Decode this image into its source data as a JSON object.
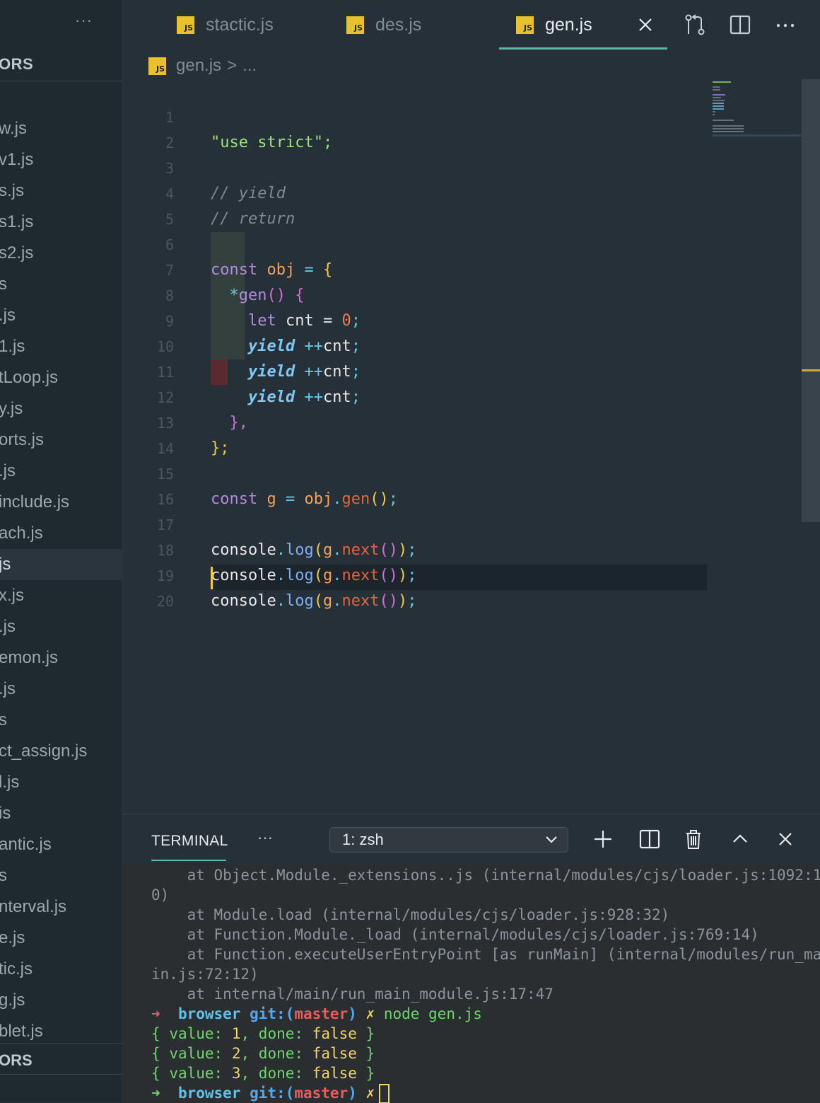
{
  "sidebar": {
    "more": "···",
    "section_title": "ORS",
    "files": [
      "w.js",
      "v1.js",
      "s.js",
      "s1.js",
      "s2.js",
      "s",
      ".js",
      "1.js",
      "tLoop.js",
      "y.js",
      "orts.js",
      ".js",
      "include.js",
      "ach.js",
      "js",
      "x.js",
      ".js",
      "emon.js",
      ".js",
      "s",
      "ct_assign.js",
      "l.js",
      "is",
      "antic.js",
      "s",
      "nterval.js",
      "e.js",
      "tic.js",
      "g.js",
      "blet.js"
    ],
    "active_index": 14,
    "bottom_section": "ORS"
  },
  "tabs": [
    {
      "label": "stactic.js",
      "badge": "JS",
      "active": false
    },
    {
      "label": "des.js",
      "badge": "JS",
      "active": false
    },
    {
      "label": "gen.js",
      "badge": "JS",
      "active": true
    }
  ],
  "breadcrumb": {
    "badge": "JS",
    "file": "gen.js",
    "separator": ">",
    "rest": "..."
  },
  "editor": {
    "line_numbers": [
      "1",
      "2",
      "3",
      "4",
      "5",
      "6",
      "7",
      "8",
      "9",
      "10",
      "11",
      "12",
      "13",
      "14",
      "15",
      "16",
      "17",
      "18",
      "19",
      "20"
    ],
    "code": {
      "l1": "\"use strict\";",
      "l3": "// yield",
      "l4": "// return",
      "l6_const": "const",
      "l6_obj": "obj",
      "l6_eq": "=",
      "l6_brace": "{",
      "l7_star": "*",
      "l7_gen": "gen",
      "l7_parens": "()",
      "l7_brace": "{",
      "l8_let": "let",
      "l8_cnt": "cnt",
      "l8_eq": "=",
      "l8_zero": "0",
      "l8_semi": ";",
      "yield_kw": "yield",
      "yield_op": "++",
      "yield_var": "cnt",
      "yield_semi": ";",
      "l12": "},",
      "l13": "};",
      "l15_const": "const",
      "l15_g": "g",
      "l15_eq": "=",
      "l15_obj": "obj",
      "l15_dot": ".",
      "l15_gen": "gen",
      "l15_parens": "()",
      "l15_semi": ";",
      "console": "console",
      "dot": ".",
      "log": "log",
      "lp": "(",
      "g": "g",
      "next": "next",
      "np": "()",
      "rp": ")",
      "semi": ";"
    }
  },
  "panel": {
    "tab": "TERMINAL",
    "more": "···",
    "shell_select": "1: zsh"
  },
  "terminal": {
    "lines": [
      "    at Object.Module._extensions..js (internal/modules/cjs/loader.js:1092:1",
      "0)",
      "    at Module.load (internal/modules/cjs/loader.js:928:32)",
      "    at Function.Module._load (internal/modules/cjs/loader.js:769:14)",
      "    at Function.executeUserEntryPoint [as runMain] (internal/modules/run_ma",
      "in.js:72:12)",
      "    at internal/main/run_main_module.js:17:47"
    ],
    "prompt_arrow": "➜",
    "prompt_dir": "browser",
    "prompt_git": "git:",
    "prompt_branch_open": "(",
    "prompt_branch": "master",
    "prompt_branch_close": ")",
    "prompt_dirty": "✗",
    "command": "node gen.js",
    "results": [
      {
        "value": "1",
        "done": "false"
      },
      {
        "value": "2",
        "done": "false"
      },
      {
        "value": "3",
        "done": "false"
      }
    ],
    "obj_open": "{",
    "obj_close": "}",
    "key_value": "value:",
    "key_done": "done:",
    "comma": ","
  },
  "colors": {
    "accent": "#5cb8a8",
    "js_badge": "#e8c12f",
    "cursor": "#f3cc3a"
  }
}
